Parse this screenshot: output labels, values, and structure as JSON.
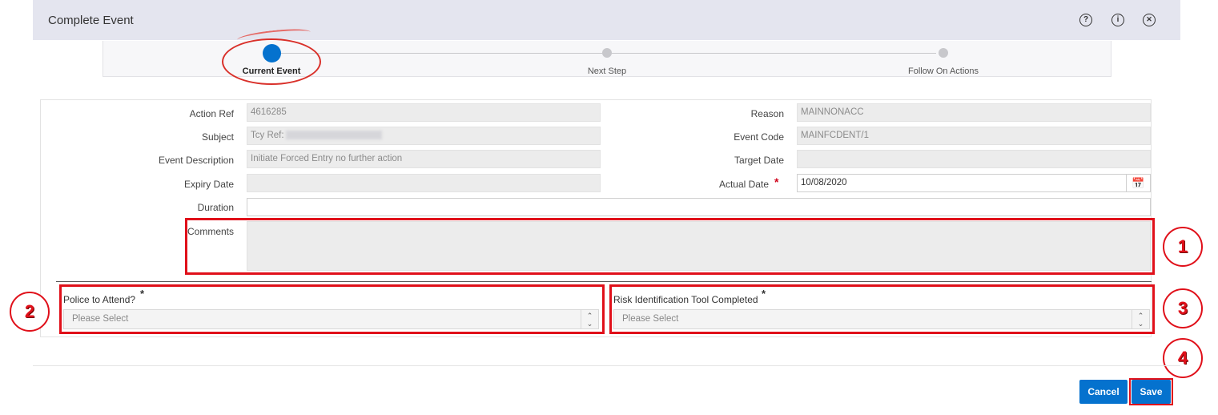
{
  "dialog": {
    "title": "Complete Event",
    "icons": [
      "help-icon",
      "info-icon",
      "close-icon"
    ],
    "help_glyph": "?",
    "info_glyph": "i",
    "close_glyph": "✕"
  },
  "stepper": {
    "steps": [
      {
        "label": "Current Event",
        "active": true
      },
      {
        "label": "Next Step",
        "active": false
      },
      {
        "label": "Follow On Actions",
        "active": false
      }
    ]
  },
  "form": {
    "action_ref": {
      "label": "Action Ref",
      "value": "4616285"
    },
    "subject": {
      "label": "Subject",
      "value": "Tcy Ref:"
    },
    "event_description": {
      "label": "Event Description",
      "value": "Initiate Forced Entry no further action"
    },
    "expiry_date": {
      "label": "Expiry Date",
      "value": ""
    },
    "duration": {
      "label": "Duration",
      "value": ""
    },
    "comments": {
      "label": "Comments",
      "value": ""
    },
    "reason": {
      "label": "Reason",
      "value": "MAINNONACC"
    },
    "event_code": {
      "label": "Event Code",
      "value": "MAINFCDENT/1"
    },
    "target_date": {
      "label": "Target Date",
      "value": ""
    },
    "actual_date": {
      "label": "Actual Date",
      "value": "10/08/2020",
      "required_mark": "*"
    },
    "police_to_attend": {
      "label": "Police to Attend?",
      "placeholder": "Please Select",
      "required_mark": "*"
    },
    "risk_tool": {
      "label": "Risk Identification Tool Completed",
      "placeholder": "Please Select",
      "required_mark": "*"
    }
  },
  "annotations": [
    "1",
    "2",
    "3",
    "4"
  ],
  "footer": {
    "cancel_label": "Cancel",
    "save_label": "Save"
  },
  "colors": {
    "accent": "#0572ce",
    "annotation_red": "#e0101a",
    "header_bg": "#e4e5ef"
  }
}
